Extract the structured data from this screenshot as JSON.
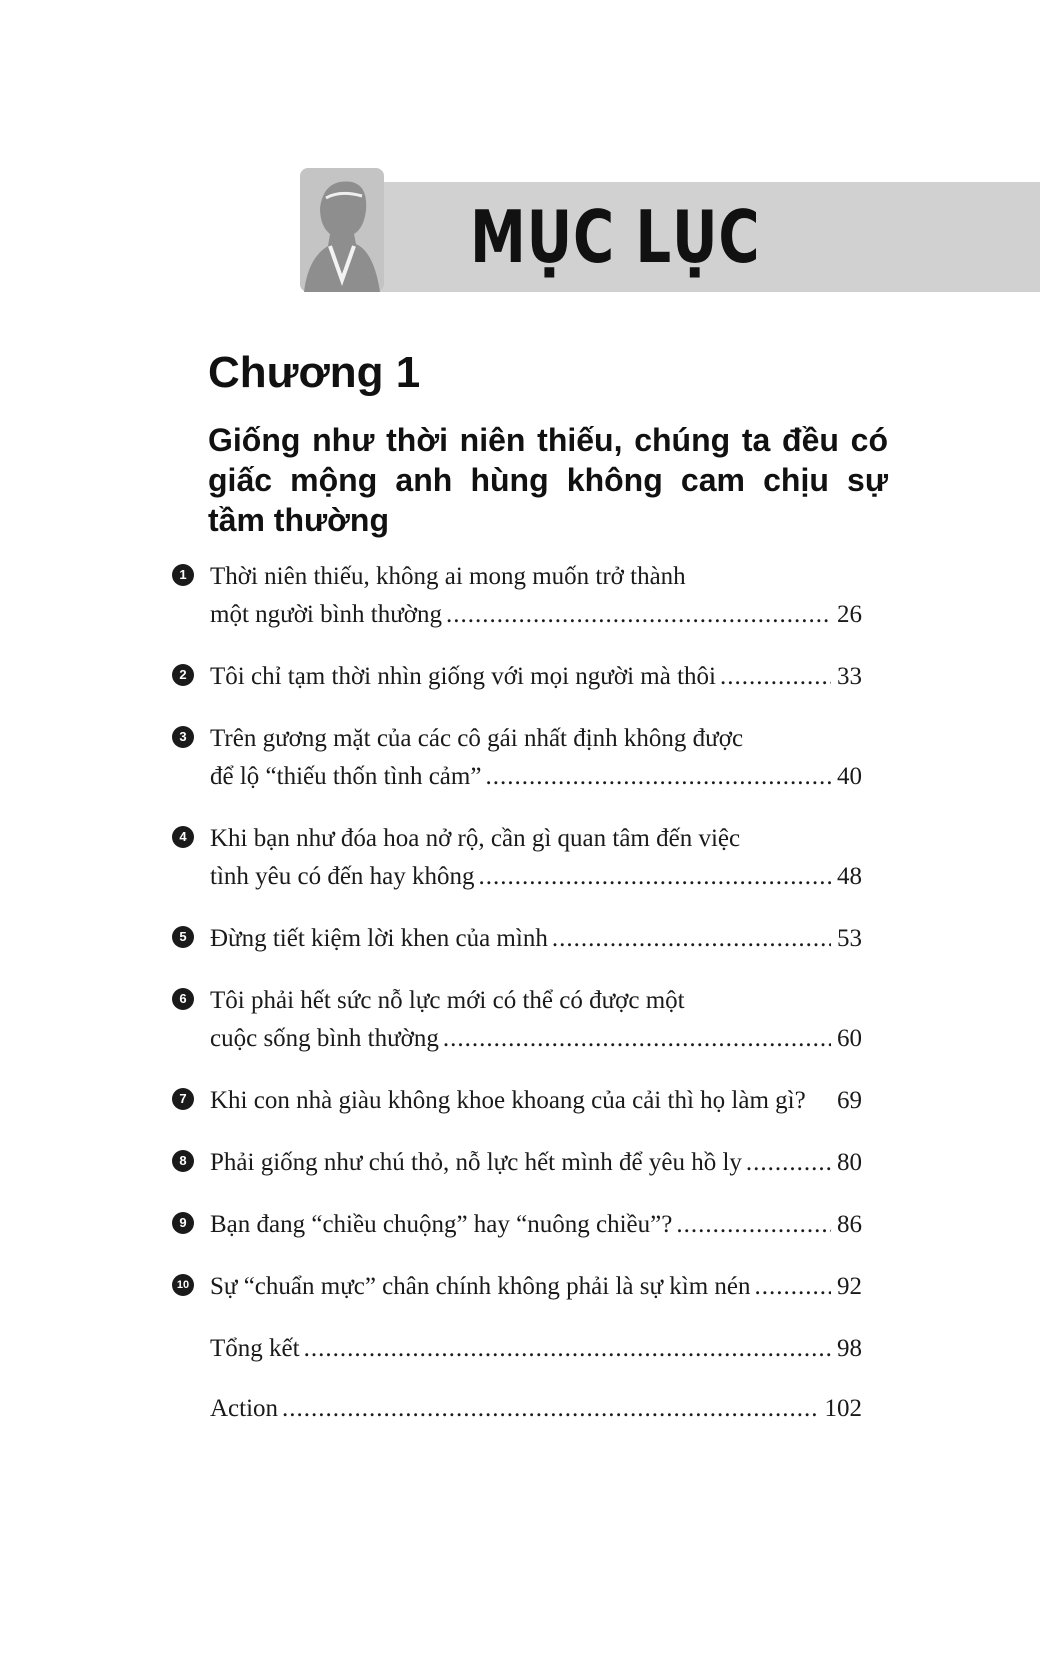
{
  "header": {
    "title": "MỤC LỤC",
    "icon": "man-silhouette-icon"
  },
  "chapter": {
    "heading": "Chương 1",
    "subtitle": "Giống như thời niên thiếu, chúng ta đều có giấc mộng anh hùng không cam chịu sự tầm thường"
  },
  "toc": [
    {
      "number": "1",
      "line1": "Thời niên thiếu, không ai mong muốn trở thành",
      "line2": "một người bình thường",
      "page": "26"
    },
    {
      "number": "2",
      "line1": "Tôi chỉ tạm thời nhìn giống với mọi người mà thôi",
      "page": "33"
    },
    {
      "number": "3",
      "line1": "Trên gương mặt của các cô gái nhất định không được",
      "line2": "để lộ “thiếu thốn tình cảm”",
      "page": "40"
    },
    {
      "number": "4",
      "line1": "Khi bạn như đóa hoa nở rộ, cần gì quan tâm đến việc",
      "line2": "tình yêu có đến hay không",
      "page": "48"
    },
    {
      "number": "5",
      "line1": "Đừng tiết kiệm lời khen của mình",
      "page": "53"
    },
    {
      "number": "6",
      "line1": "Tôi phải hết sức nỗ lực mới có thể có được một",
      "line2": "cuộc sống bình thường",
      "page": "60"
    },
    {
      "number": "7",
      "line1": "Khi con nhà giàu không khoe khoang của cải thì họ làm gì?",
      "page": "69"
    },
    {
      "number": "8",
      "line1": "Phải giống như chú thỏ, nỗ lực hết mình để yêu hồ ly",
      "page": "80"
    },
    {
      "number": "9",
      "line1": "Bạn đang “chiều chuộng” hay “nuông chiều”?",
      "page": "86"
    },
    {
      "number": "10",
      "line1": "Sự “chuẩn mực” chân chính không phải là sự kìm nén",
      "page": "92"
    },
    {
      "line1": "Tổng kết",
      "page": "98"
    },
    {
      "line1": "Action",
      "page": "102"
    }
  ]
}
